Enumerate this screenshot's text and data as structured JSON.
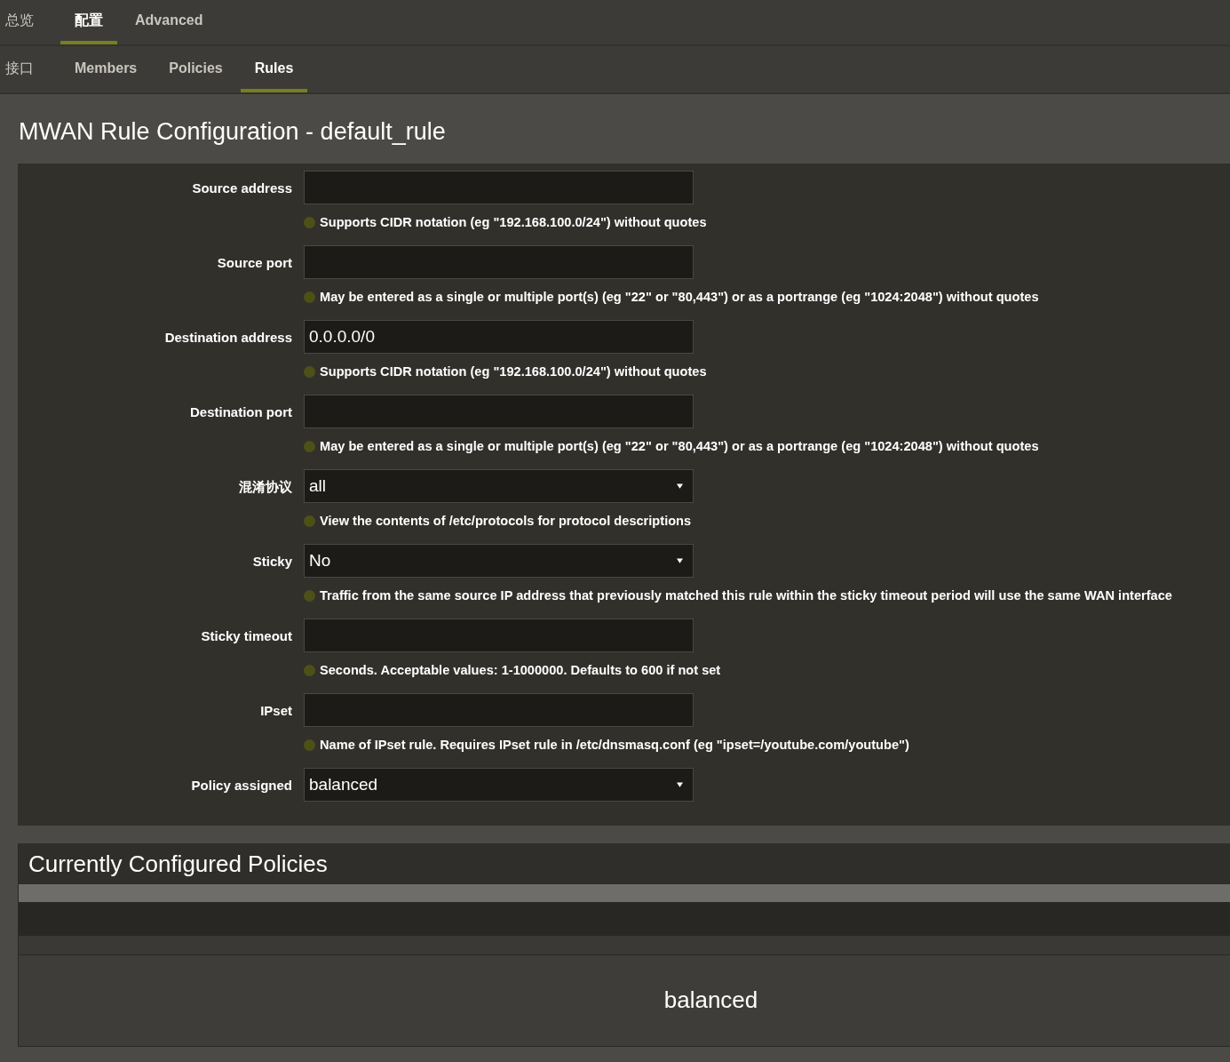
{
  "tabs": [
    {
      "label": "总览",
      "selected": false
    },
    {
      "label": "配置",
      "selected": true
    },
    {
      "label": "Advanced",
      "selected": false
    }
  ],
  "subtabs": [
    {
      "label": "接口",
      "selected": false
    },
    {
      "label": "Members",
      "selected": false
    },
    {
      "label": "Policies",
      "selected": false
    },
    {
      "label": "Rules",
      "selected": true
    }
  ],
  "title": "MWAN Rule Configuration - default_rule",
  "fields": [
    {
      "label": "Source address",
      "kind": "text",
      "help": "Supports CIDR notation (eg \"192.168.100.0/24\") without quotes"
    },
    {
      "label": "Source port",
      "kind": "text",
      "help": "May be entered as a single or multiple port(s) (eg \"22\" or \"80,443\") or as a portrange (eg \"1024:2048\") without quotes"
    },
    {
      "label": "Destination address",
      "kind": "text",
      "value": "0.0.0.0/0",
      "help": "Supports CIDR notation (eg \"192.168.100.0/24\") without quotes"
    },
    {
      "label": "Destination port",
      "kind": "text",
      "help": "May be entered as a single or multiple port(s) (eg \"22\" or \"80,443\") or as a portrange (eg \"1024:2048\") without quotes"
    },
    {
      "label": "混淆协议",
      "kind": "select",
      "value": "all",
      "help": "View the contents of /etc/protocols for protocol descriptions"
    },
    {
      "label": "Sticky",
      "kind": "select",
      "value": "No",
      "help": "Traffic from the same source IP address that previously matched this rule within the sticky timeout period will use the same WAN interface"
    },
    {
      "label": "Sticky timeout",
      "kind": "text",
      "help": "Seconds. Acceptable values: 1-1000000. Defaults to 600 if not set"
    },
    {
      "label": "IPset",
      "kind": "text",
      "help": "Name of IPset rule. Requires IPset rule in /etc/dnsmasq.conf (eg \"ipset=/youtube.com/youtube\")"
    },
    {
      "label": "Policy assigned",
      "kind": "select",
      "value": "balanced"
    }
  ],
  "policies": {
    "title": "Currently Configured Policies",
    "rows": [
      {
        "name": "balanced"
      }
    ]
  }
}
